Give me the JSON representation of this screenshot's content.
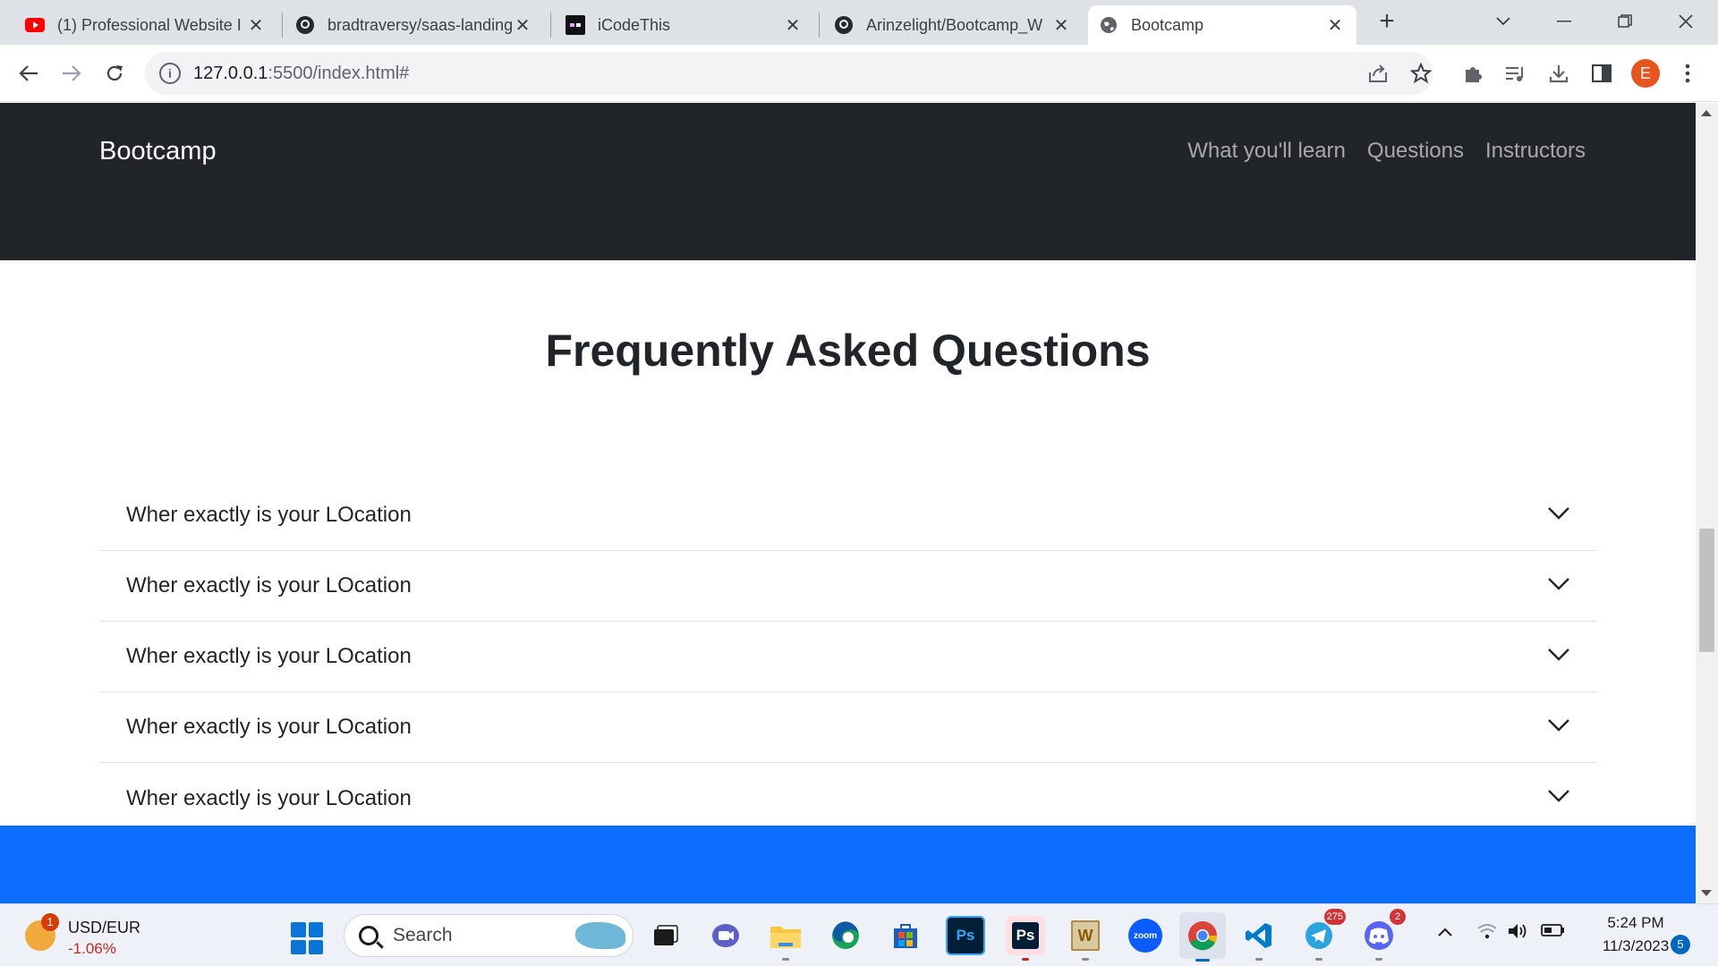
{
  "browser": {
    "tabs": [
      {
        "title": "(1) Professional Website I",
        "icon": "youtube-icon"
      },
      {
        "title": "bradtraversy/saas-landing",
        "icon": "github-icon"
      },
      {
        "title": "iCodeThis",
        "icon": "icodethis-icon"
      },
      {
        "title": "Arinzelight/Bootcamp_W",
        "icon": "github-icon"
      },
      {
        "title": "Bootcamp",
        "icon": "globe-icon"
      }
    ],
    "url_host": "127.0.0.1",
    "url_rest": ":5500/index.html#",
    "profile_initial": "E"
  },
  "page": {
    "brand": "Bootcamp",
    "nav": [
      "What you'll learn",
      "Questions",
      "Instructors"
    ],
    "faq_title": "Frequently Asked Questions",
    "faq_items": [
      "Wher exactly is your LOcation",
      "Wher exactly is your LOcation",
      "Wher exactly is your LOcation",
      "Wher exactly is your LOcation",
      "Wher exactly is your LOcation"
    ],
    "colors": {
      "navbar": "#212529",
      "band": "#0d6efd"
    }
  },
  "taskbar": {
    "widget_badge": "1",
    "widget_title": "USD/EUR",
    "widget_value": "-1.06%",
    "search_placeholder": "Search",
    "telegram_count": "275",
    "discord_count": "2",
    "photoshop_label": "Ps",
    "word_label": "W",
    "zoom_label": "zoom",
    "time": "5:24 PM",
    "date": "11/3/2023",
    "notifications": "5"
  }
}
